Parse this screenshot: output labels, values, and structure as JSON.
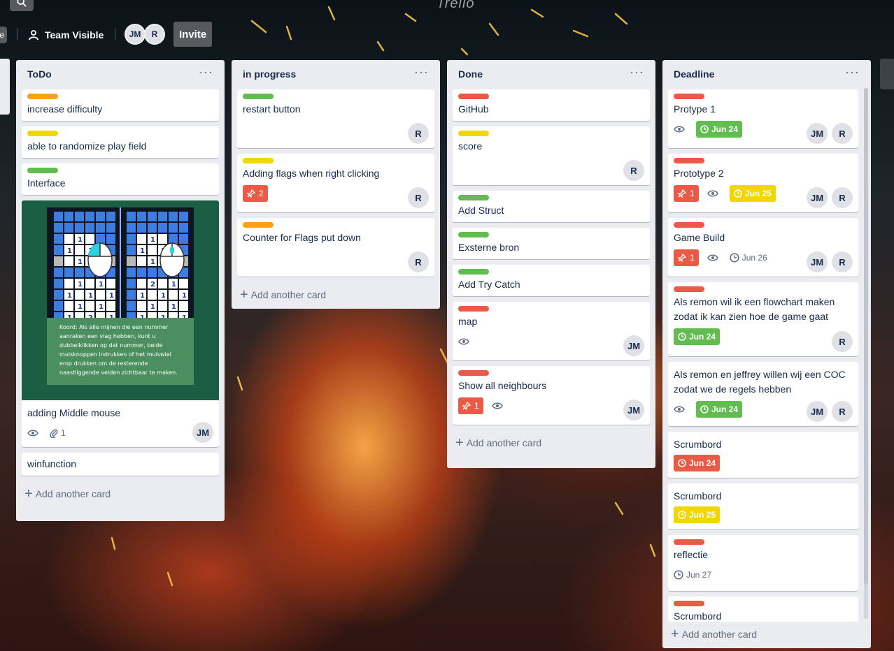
{
  "header": {
    "board_chip": "e",
    "visibility": "Team Visible",
    "members": [
      "JM",
      "R"
    ],
    "invite": "Invite",
    "logo": "Trello"
  },
  "colors": {
    "green": "#61bd4f",
    "yellow": "#f2d600",
    "orange": "#ff9f1a",
    "red": "#eb5a46"
  },
  "lists": {
    "todo": {
      "title": "ToDo",
      "add": "Add another card",
      "cards": [
        {
          "title": "increase difficulty"
        },
        {
          "title": "able to randomize play field"
        },
        {
          "title": "Interface"
        },
        {
          "title": "adding Middle mouse",
          "attachments": "1",
          "member": "JM",
          "cover_text": "Koord: Als alle mijnen die een nummer aanraken een vlag hebben, kunt u dubbelklikken op dat nummer, beide muisknoppen indrukken of het muiswiel erop drukken om de resterende naastliggende velden zichtbaar te maken.",
          "cover_numbers": [
            "1",
            "1",
            "1",
            "1",
            "1",
            "1",
            "1",
            "1",
            "1",
            "1",
            "1",
            "1",
            "2",
            "1",
            "1",
            "1",
            "1",
            "1",
            "2",
            "1",
            "1",
            "1",
            "1",
            "1",
            "1",
            "1",
            "1",
            "1"
          ]
        },
        {
          "title": "winfunction"
        }
      ]
    },
    "progress": {
      "title": "in progress",
      "add": "Add another card",
      "cards": [
        {
          "title": "restart button",
          "member": "R"
        },
        {
          "title": "Adding flags when right clicking",
          "votes": "2",
          "member": "R"
        },
        {
          "title": "Counter for Flags put down",
          "member": "R"
        }
      ]
    },
    "done": {
      "title": "Done",
      "add": "Add another card",
      "cards": [
        {
          "title": "GitHub"
        },
        {
          "title": "score",
          "member": "R"
        },
        {
          "title": "Add Struct"
        },
        {
          "title": "Exsterne bron"
        },
        {
          "title": "Add Try Catch"
        },
        {
          "title": "map",
          "member": "JM"
        },
        {
          "title": "Show all neighbours",
          "votes": "1",
          "member": "JM"
        }
      ]
    },
    "deadline": {
      "title": "Deadline",
      "add": "Add another card",
      "cards": [
        {
          "title": "Protype 1",
          "due": "Jun 24",
          "members": [
            "JM",
            "R"
          ]
        },
        {
          "title": "Prototype 2",
          "votes": "1",
          "due": "Jun 25",
          "members": [
            "JM",
            "R"
          ]
        },
        {
          "title": "Game Build",
          "votes": "1",
          "due": "Jun 26",
          "members": [
            "JM",
            "R"
          ]
        },
        {
          "title": "Als remon wil ik een flowchart maken zodat ik kan zien hoe de game gaat",
          "due": "Jun 24",
          "member": "R"
        },
        {
          "title": "Als remon en jeffrey willen wij een COC zodat we de regels hebben",
          "due": "Jun 24",
          "members": [
            "JM",
            "R"
          ]
        },
        {
          "title": "Scrumbord",
          "due": "Jun 24"
        },
        {
          "title": "Scrumbord",
          "due": "Jun 25"
        },
        {
          "title": "reflectie",
          "due": "Jun 27"
        },
        {
          "title": "Scrumbord"
        }
      ]
    }
  }
}
